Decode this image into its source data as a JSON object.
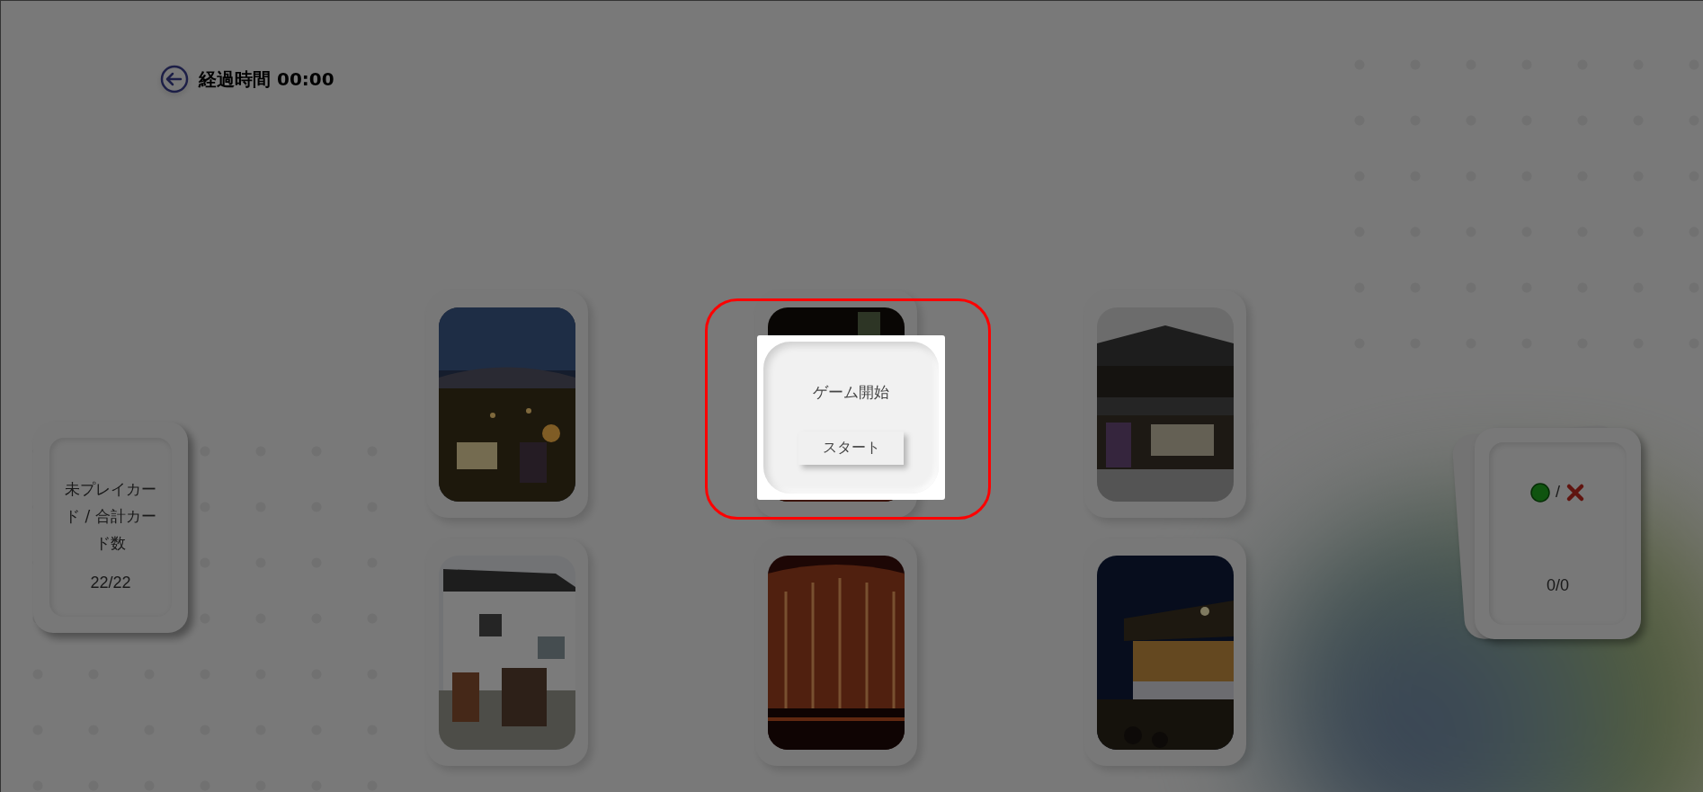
{
  "header": {
    "elapsed": "経過時間 00:00"
  },
  "unplayed_card": {
    "label": "未プレイカード / 合計カード数",
    "count": "22/22"
  },
  "score_card": {
    "separator": "/",
    "count": "0/0"
  },
  "dialog": {
    "title": "ゲーム開始",
    "button": "スタート"
  }
}
